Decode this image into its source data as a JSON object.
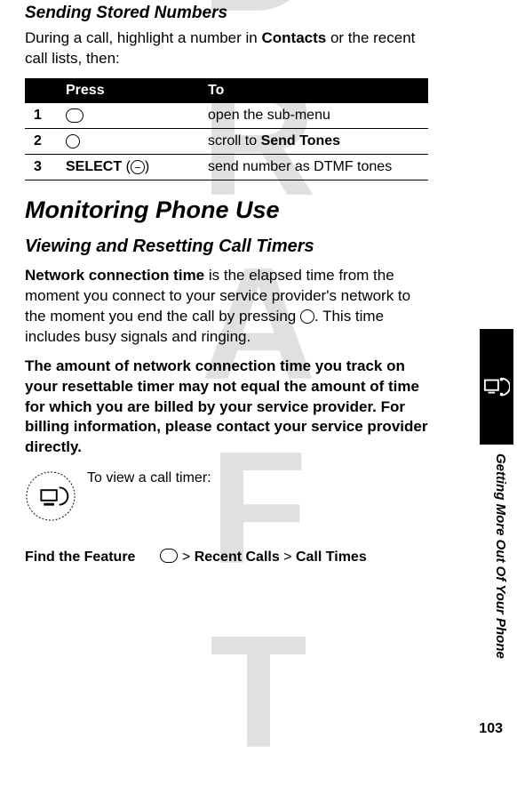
{
  "watermark": "DRAFT",
  "section1": {
    "title": "Sending Stored Numbers",
    "intro_pre": "During a call, highlight a number in ",
    "intro_bold": "Contacts",
    "intro_post": " or the recent call lists, then:"
  },
  "table": {
    "head_empty": "",
    "head_press": "Press",
    "head_to": "To",
    "rows": [
      {
        "n": "1",
        "keytype": "menu",
        "to": "open the sub-menu"
      },
      {
        "n": "2",
        "keytype": "nav",
        "to_pre": "scroll to ",
        "to_bold": "Send Tones"
      },
      {
        "n": "3",
        "keytype": "select",
        "key_label": "SELECT",
        "to": "send number as DTMF tones"
      }
    ]
  },
  "section2": {
    "heading": "Monitoring Phone Use",
    "sub": "Viewing and Resetting Call Timers",
    "p1_bold": "Network connection time",
    "p1_rest": " is the elapsed time from the moment you connect to your service provider's network to the moment you end the call by pressing ",
    "p1_tail": ". This time includes busy signals and ringing.",
    "p2": "The amount of network connection time you track on your resettable timer may not equal the amount of time for which you are billed by your service provider. For billing information, please contact your service provider directly.",
    "view_label": "To view a call timer:",
    "badge_text": "Network / Subscription Dependent Feature"
  },
  "find_feature": {
    "label": "Find the Feature",
    "path_sep": " > ",
    "path": [
      "Recent Calls",
      "Call Times"
    ]
  },
  "side": {
    "caption": "Getting More Out Of Your Phone"
  },
  "page_number": "103"
}
